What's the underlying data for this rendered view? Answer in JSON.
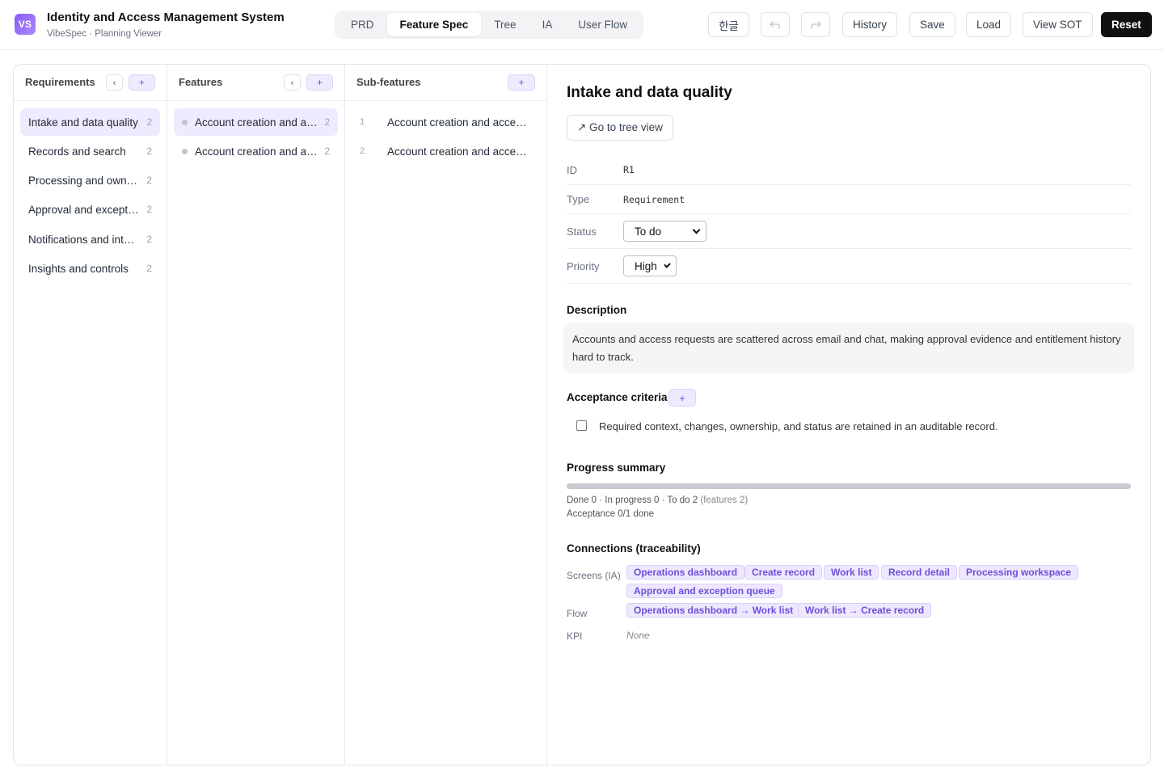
{
  "app": {
    "logo": "VS",
    "title": "Identity and Access Management System",
    "subtitle": "VibeSpec · Planning Viewer"
  },
  "tabs": [
    {
      "label": "PRD",
      "active": false
    },
    {
      "label": "Feature Spec",
      "active": true
    },
    {
      "label": "Tree",
      "active": false
    },
    {
      "label": "IA",
      "active": false
    },
    {
      "label": "User Flow",
      "active": false
    }
  ],
  "toolbar": {
    "lang_label": "한글",
    "undo_icon": "undo-icon",
    "redo_icon": "redo-icon",
    "history_label": "History",
    "save_label": "Save",
    "load_label": "Load",
    "view_sot_label": "View SOT",
    "reset_label": "Reset"
  },
  "columns": {
    "requirements": {
      "title": "Requirements",
      "collapse_label": "‹",
      "add_label": "+",
      "items": [
        {
          "label": "Intake and data quality",
          "count": "2",
          "selected": true
        },
        {
          "label": "Records and search",
          "count": "2",
          "selected": false
        },
        {
          "label": "Processing and ownership",
          "count": "2",
          "selected": false
        },
        {
          "label": "Approval and exceptions",
          "count": "2",
          "selected": false
        },
        {
          "label": "Notifications and integrations",
          "count": "2",
          "selected": false
        },
        {
          "label": "Insights and controls",
          "count": "2",
          "selected": false
        }
      ]
    },
    "features": {
      "title": "Features",
      "collapse_label": "‹",
      "add_label": "+",
      "items": [
        {
          "label": "Account creation and access requests",
          "count": "2",
          "selected": true
        },
        {
          "label": "Account creation and access reviews",
          "count": "2",
          "selected": false
        }
      ]
    },
    "subfeatures": {
      "title": "Sub-features",
      "add_label": "+",
      "items": [
        {
          "num": "1",
          "label": "Account creation and access intake"
        },
        {
          "num": "2",
          "label": "Account creation and access validation"
        }
      ]
    }
  },
  "detail": {
    "title": "Intake and data quality",
    "goto_label": "↗ Go to tree view",
    "props": {
      "id_label": "ID",
      "id_value": "R1",
      "type_label": "Type",
      "type_value": "Requirement",
      "status_label": "Status",
      "status_value": "To do",
      "priority_label": "Priority",
      "priority_value": "High"
    },
    "description_title": "Description",
    "description": "Accounts and access requests are scattered across email and chat, making approval evidence and entitlement history hard to track.",
    "acceptance_title": "Acceptance criteria",
    "acceptance_add": "+",
    "acceptance_items": [
      {
        "text": "Required context, changes, ownership, and status are retained in an auditable record.",
        "checked": false
      }
    ],
    "progress_title": "Progress summary",
    "progress_fraction": 0,
    "progress_line1": "Done 0 · In progress 0 · To do 2",
    "progress_features": "(features 2)",
    "progress_line2": "Acceptance 0/1 done",
    "connections_title": "Connections (traceability)",
    "screens_label": "Screens (IA)",
    "screens": [
      "Operations dashboard",
      "Create record",
      "Work list",
      "Record detail",
      "Processing workspace",
      "Approval and exception queue"
    ],
    "flow_label": "Flow",
    "flows": [
      "Operations dashboard → Work list",
      "Work list → Create record"
    ],
    "kpi_label": "KPI",
    "kpi_value": "None"
  },
  "colors": {
    "accent": "#8b5cf6",
    "accent_soft": "#efeafd",
    "dark_button": "#111111"
  }
}
